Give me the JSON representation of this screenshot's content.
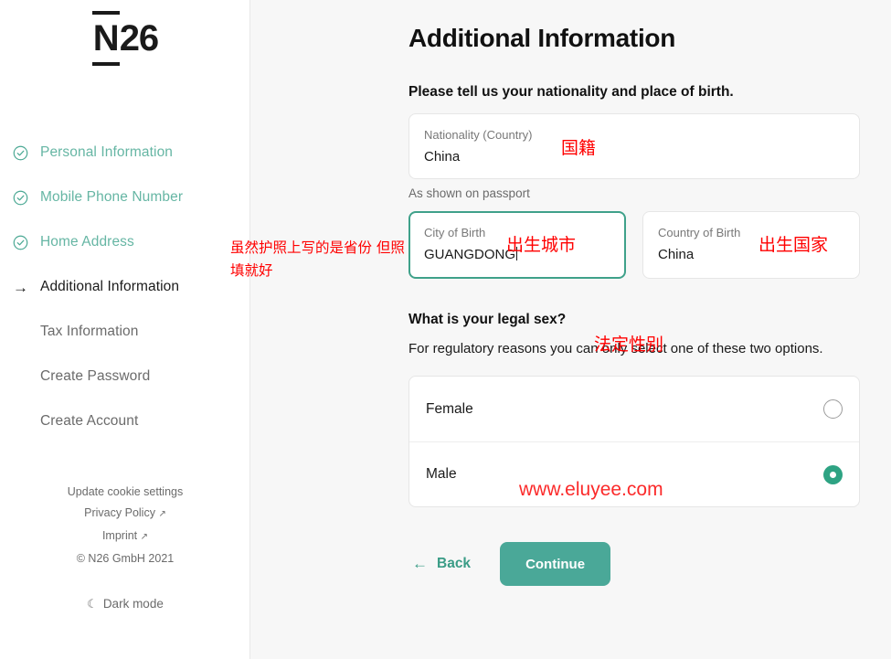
{
  "sidebar": {
    "logo": {
      "n": "N",
      "rest": "26"
    },
    "nav_items": [
      {
        "label": "Personal Information",
        "state": "done",
        "icon": "check-circle-icon"
      },
      {
        "label": "Mobile Phone Number",
        "state": "done",
        "icon": "check-circle-icon"
      },
      {
        "label": "Home Address",
        "state": "done",
        "icon": "check-circle-icon"
      },
      {
        "label": "Additional Information",
        "state": "active",
        "icon": "arrow-right-icon"
      },
      {
        "label": "Tax Information",
        "state": "todo",
        "icon": ""
      },
      {
        "label": "Create Password",
        "state": "todo",
        "icon": ""
      },
      {
        "label": "Create Account",
        "state": "todo",
        "icon": ""
      }
    ],
    "footer": {
      "cookie_settings": "Update cookie settings",
      "privacy_policy": "Privacy Policy",
      "imprint": "Imprint",
      "external_glyph": "↗",
      "copyright": "© N26 GmbH 2021",
      "dark_mode": "Dark mode",
      "moon_glyph": "☾"
    }
  },
  "main": {
    "title": "Additional Information",
    "nationality_prompt": "Please tell us your nationality and place of birth.",
    "nationality_field": {
      "label": "Nationality (Country)",
      "value": "China"
    },
    "helper_text": "As shown on passport",
    "city_field": {
      "label": "City of Birth",
      "value": "GUANGDONG",
      "focused": true
    },
    "country_field": {
      "label": "Country of Birth",
      "value": "China"
    },
    "legal_sex_question": "What is your legal sex?",
    "legal_sex_subtext": "For regulatory reasons you can only select one of these two options.",
    "sex_options": [
      {
        "label": "Female",
        "selected": false
      },
      {
        "label": "Male",
        "selected": true
      }
    ],
    "back_label": "Back",
    "back_arrow": "←",
    "continue_label": "Continue"
  },
  "annotations": {
    "side_note": "虽然护照上写的是省份 但照填就好",
    "nationality": "国籍",
    "city_of_birth": "出生城市",
    "country_of_birth": "出生国家",
    "legal_sex": "法定性别",
    "watermark": "www.eluyee.com"
  },
  "colors": {
    "accent_green": "#2ea383",
    "button_green": "#4aa898",
    "done_green": "#66b6a4",
    "annotation_red": "#ff0000",
    "page_bg": "#f7f7f7"
  }
}
